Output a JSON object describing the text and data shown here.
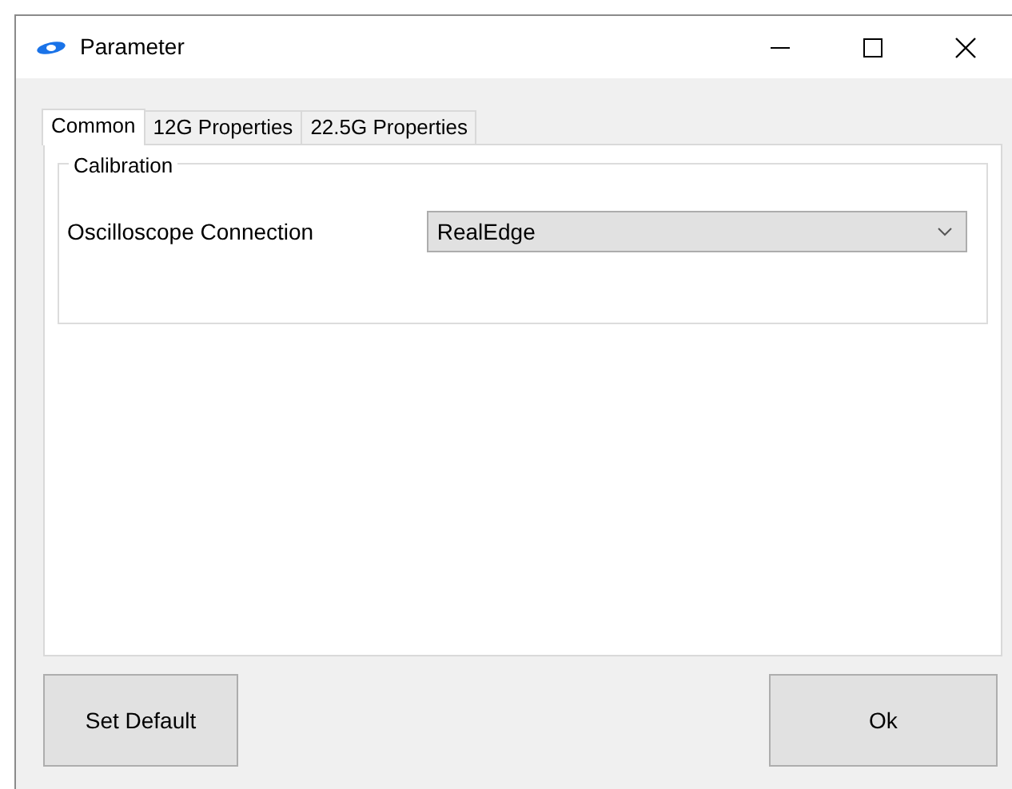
{
  "window": {
    "title": "Parameter"
  },
  "tabs": [
    {
      "label": "Common",
      "selected": true
    },
    {
      "label": "12G Properties",
      "selected": false
    },
    {
      "label": "22.5G Properties",
      "selected": false
    }
  ],
  "group": {
    "title": "Calibration",
    "fields": [
      {
        "label": "Oscilloscope Connection",
        "value": "RealEdge"
      }
    ]
  },
  "buttons": [
    {
      "label": "Set Default"
    },
    {
      "label": "Ok"
    }
  ]
}
